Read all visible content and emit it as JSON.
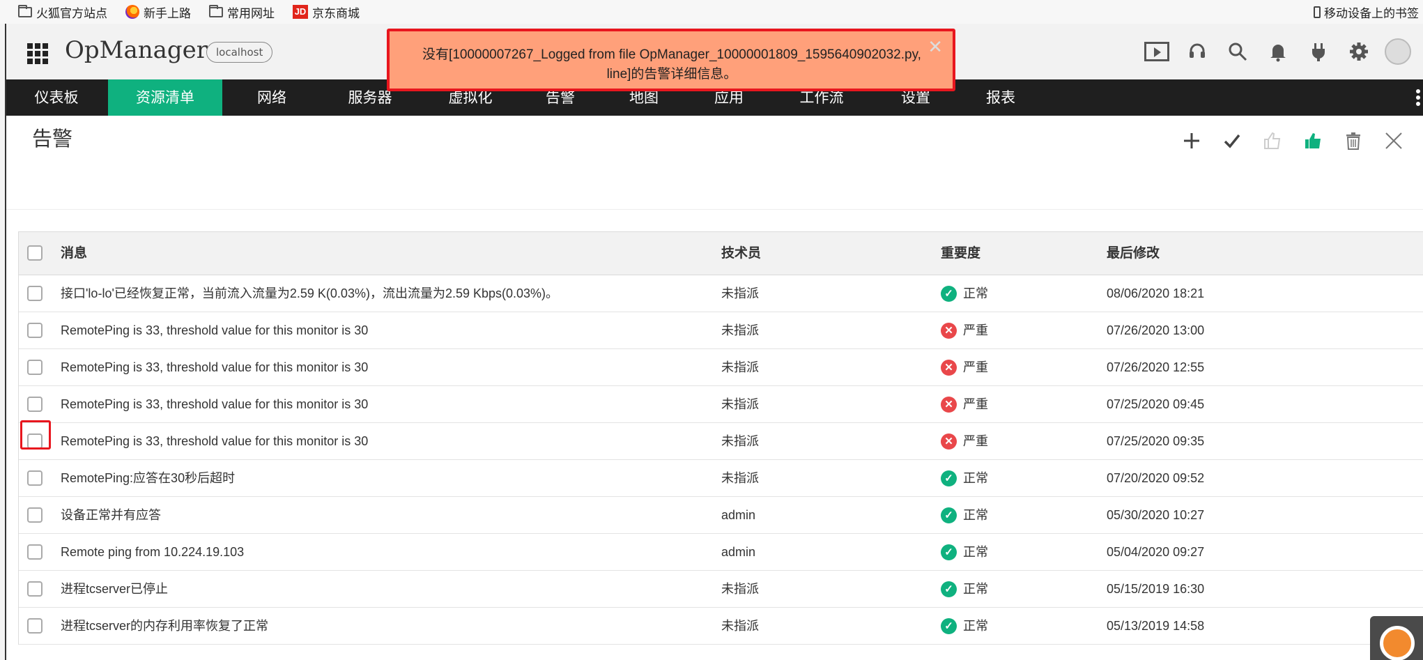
{
  "bookmarks": {
    "items": [
      {
        "label": "火狐官方站点",
        "icon": "folder-icon"
      },
      {
        "label": "新手上路",
        "icon": "firefox-icon"
      },
      {
        "label": "常用网址",
        "icon": "folder-icon"
      },
      {
        "label": "京东商城",
        "icon": "jd-icon",
        "badge": "JD"
      }
    ],
    "mobile": "移动设备上的书签"
  },
  "header": {
    "brand": "OpManager",
    "host": "localhost"
  },
  "nav": {
    "items": [
      {
        "label": "仪表板"
      },
      {
        "label": "资源清单"
      },
      {
        "label": "网络"
      },
      {
        "label": "服务器"
      },
      {
        "label": "虚拟化"
      },
      {
        "label": "告警"
      },
      {
        "label": "地图"
      },
      {
        "label": "应用"
      },
      {
        "label": "工作流"
      },
      {
        "label": "设置"
      },
      {
        "label": "报表"
      }
    ],
    "active_index": 1
  },
  "toast": {
    "message": "没有[10000007267_Logged from file OpManager_10000001809_1595640902032.py, line]的告警详细信息。",
    "close": "✕"
  },
  "page": {
    "title": "告警"
  },
  "table": {
    "headers": {
      "message": "消息",
      "technician": "技术员",
      "severity": "重要度",
      "modified": "最后修改"
    },
    "rows": [
      {
        "message": "接口'lo-lo'已经恢复正常，当前流入流量为2.59 K(0.03%)，流出流量为2.59 Kbps(0.03%)。",
        "technician": "未指派",
        "severity": "正常",
        "level": "ok",
        "modified": "08/06/2020 18:21"
      },
      {
        "message": "RemotePing is 33, threshold value for this monitor is 30",
        "technician": "未指派",
        "severity": "严重",
        "level": "crit",
        "modified": "07/26/2020 13:00"
      },
      {
        "message": "RemotePing is 33, threshold value for this monitor is 30",
        "technician": "未指派",
        "severity": "严重",
        "level": "crit",
        "modified": "07/26/2020 12:55"
      },
      {
        "message": "RemotePing is 33, threshold value for this monitor is 30",
        "technician": "未指派",
        "severity": "严重",
        "level": "crit",
        "modified": "07/25/2020 09:45"
      },
      {
        "message": "RemotePing is 33, threshold value for this monitor is 30",
        "technician": "未指派",
        "severity": "严重",
        "level": "crit",
        "modified": "07/25/2020 09:35"
      },
      {
        "message": "RemotePing:应答在30秒后超时",
        "technician": "未指派",
        "severity": "正常",
        "level": "ok",
        "modified": "07/20/2020 09:52"
      },
      {
        "message": "设备正常并有应答",
        "technician": "admin",
        "severity": "正常",
        "level": "ok",
        "modified": "05/30/2020 10:27"
      },
      {
        "message": "Remote ping from 10.224.19.103",
        "technician": "admin",
        "severity": "正常",
        "level": "ok",
        "modified": "05/04/2020 09:27"
      },
      {
        "message": "进程tcserver已停止",
        "technician": "未指派",
        "severity": "正常",
        "level": "ok",
        "modified": "05/15/2019 16:30"
      },
      {
        "message": "进程tcserver的内存利用率恢复了正常",
        "technician": "未指派",
        "severity": "正常",
        "level": "ok",
        "modified": "05/13/2019 14:58"
      }
    ]
  },
  "colors": {
    "accent": "#0fb17f",
    "nav_bg": "#1f1f1f",
    "critical": "#e9474a",
    "toast_bg": "#ffa07a",
    "highlight": "#e8161e"
  }
}
